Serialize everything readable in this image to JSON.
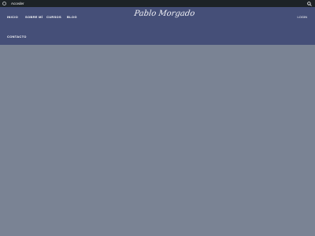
{
  "admin_bar": {
    "login_label": "Acceder",
    "icons": [
      "wordpress-icon",
      "search-icon"
    ]
  },
  "header": {
    "logo_text": "Pablo Morgado",
    "nav": [
      "INICIO",
      "SOBRE MÍ",
      "CURSOS",
      "BLOG",
      "CONTACTO"
    ],
    "login_label": "LOGIN"
  },
  "colors": {
    "admin_bar": "#1d2327",
    "header": "#454f78",
    "background": "#7a8394"
  }
}
